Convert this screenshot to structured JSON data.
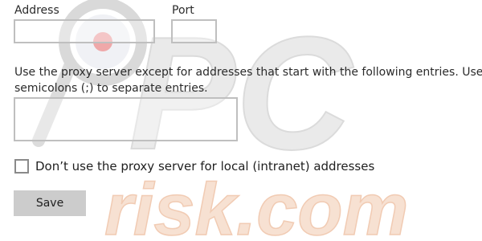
{
  "address": {
    "label": "Address",
    "value": ""
  },
  "port": {
    "label": "Port",
    "value": ""
  },
  "exceptions": {
    "description": "Use the proxy server except for addresses that start with the following entries. Use semicolons (;) to separate entries.",
    "value": ""
  },
  "local_bypass": {
    "label": "Don’t use the proxy server for local (intranet) addresses",
    "checked": false
  },
  "save_button": {
    "label": "Save"
  },
  "watermark": {
    "logo_text": "PC",
    "site_text": "risk.com",
    "colors": {
      "logo": "#d3d3d3",
      "site": "#f3c9b2",
      "magnifier_ring": "#cfcfcf",
      "magnifier_dot": "#e98f8f"
    }
  }
}
